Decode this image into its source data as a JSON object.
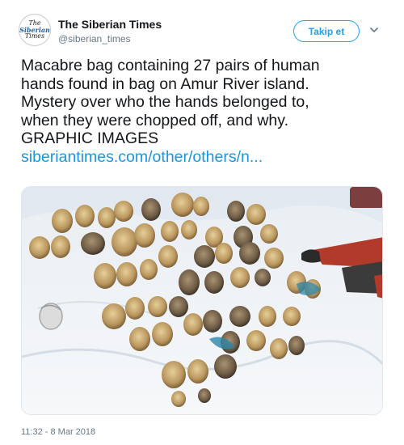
{
  "account": {
    "display_name": "The Siberian Times",
    "handle": "@siberian_times",
    "avatar_lines": [
      "The",
      "Siberian",
      "Times"
    ]
  },
  "follow_label": "Takip et",
  "tweet": {
    "lines": [
      "Macabre bag containing 27 pairs of human",
      "hands found in bag on Amur River island.",
      "Mystery over who the hands belonged to,",
      "when they were chopped off, and why.",
      "GRAPHIC IMAGES"
    ],
    "link": "siberiantimes.com/other/others/n..."
  },
  "timestamp": "11:32 - 8 Mar 2018",
  "colors": {
    "accent": "#1da1f2",
    "link": "#1b95e0",
    "muted": "#657786"
  },
  "icons": {
    "menu": "chevron-down-icon"
  }
}
